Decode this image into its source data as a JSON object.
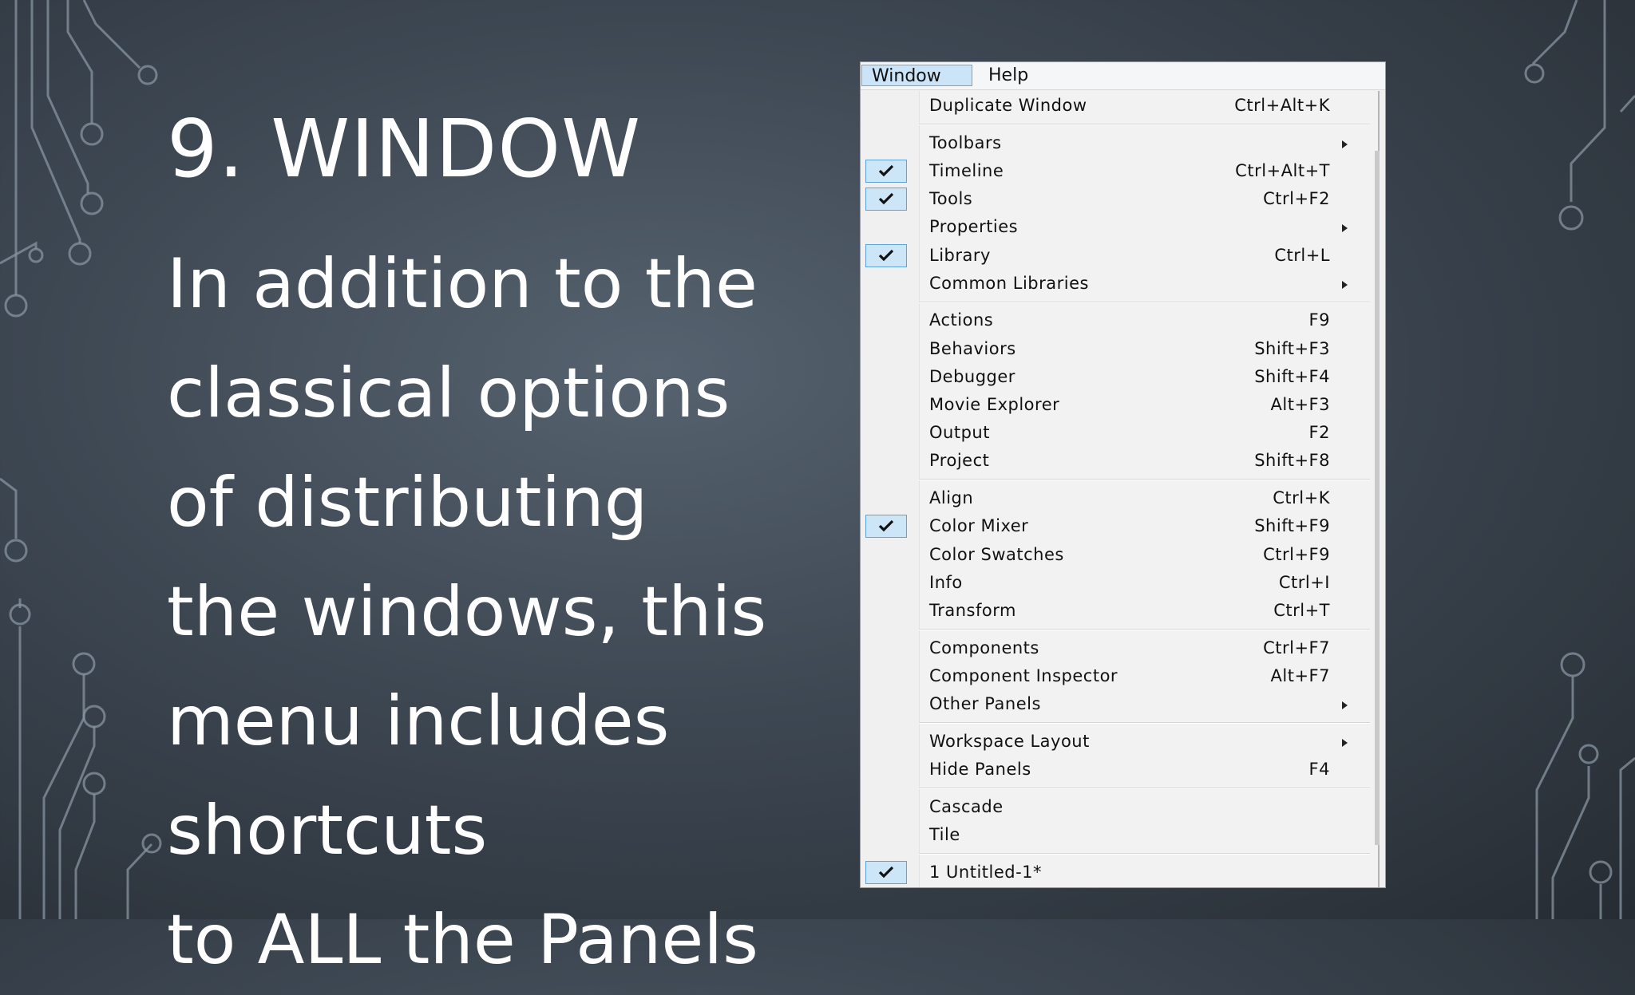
{
  "slide": {
    "title": "9. WINDOW",
    "body_lines": [
      "In addition to the",
      "classical options",
      "of distributing",
      "the windows, this",
      "menu includes",
      "shortcuts",
      "to ALL the Panels"
    ]
  },
  "menubar": {
    "window_label": "Window",
    "help_label": "Help"
  },
  "menu": {
    "items": [
      {
        "label": "Duplicate Window",
        "shortcut": "Ctrl+Alt+K"
      },
      {
        "label": "Toolbars",
        "submenu": true
      },
      {
        "label": "Timeline",
        "shortcut": "Ctrl+Alt+T",
        "checked": true
      },
      {
        "label": "Tools",
        "shortcut": "Ctrl+F2",
        "checked": true
      },
      {
        "label": "Properties",
        "submenu": true
      },
      {
        "label": "Library",
        "shortcut": "Ctrl+L",
        "checked": true
      },
      {
        "label": "Common Libraries",
        "submenu": true
      },
      {
        "label": "Actions",
        "shortcut": "F9"
      },
      {
        "label": "Behaviors",
        "shortcut": "Shift+F3"
      },
      {
        "label": "Debugger",
        "shortcut": "Shift+F4"
      },
      {
        "label": "Movie Explorer",
        "shortcut": "Alt+F3"
      },
      {
        "label": "Output",
        "shortcut": "F2"
      },
      {
        "label": "Project",
        "shortcut": "Shift+F8"
      },
      {
        "label": "Align",
        "shortcut": "Ctrl+K"
      },
      {
        "label": "Color Mixer",
        "shortcut": "Shift+F9",
        "checked": true
      },
      {
        "label": "Color Swatches",
        "shortcut": "Ctrl+F9"
      },
      {
        "label": "Info",
        "shortcut": "Ctrl+I"
      },
      {
        "label": "Transform",
        "shortcut": "Ctrl+T"
      },
      {
        "label": "Components",
        "shortcut": "Ctrl+F7"
      },
      {
        "label": "Component Inspector",
        "shortcut": "Alt+F7"
      },
      {
        "label": "Other Panels",
        "submenu": true
      },
      {
        "label": "Workspace Layout",
        "submenu": true
      },
      {
        "label": "Hide Panels",
        "shortcut": "F4"
      },
      {
        "label": "Cascade"
      },
      {
        "label": "Tile"
      },
      {
        "label": "1 Untitled-1*",
        "checked": true
      }
    ]
  },
  "colors": {
    "check_bg": "#cde6f7",
    "check_border": "#5ea4d8",
    "active_menu_bg": "#cce4f7"
  }
}
